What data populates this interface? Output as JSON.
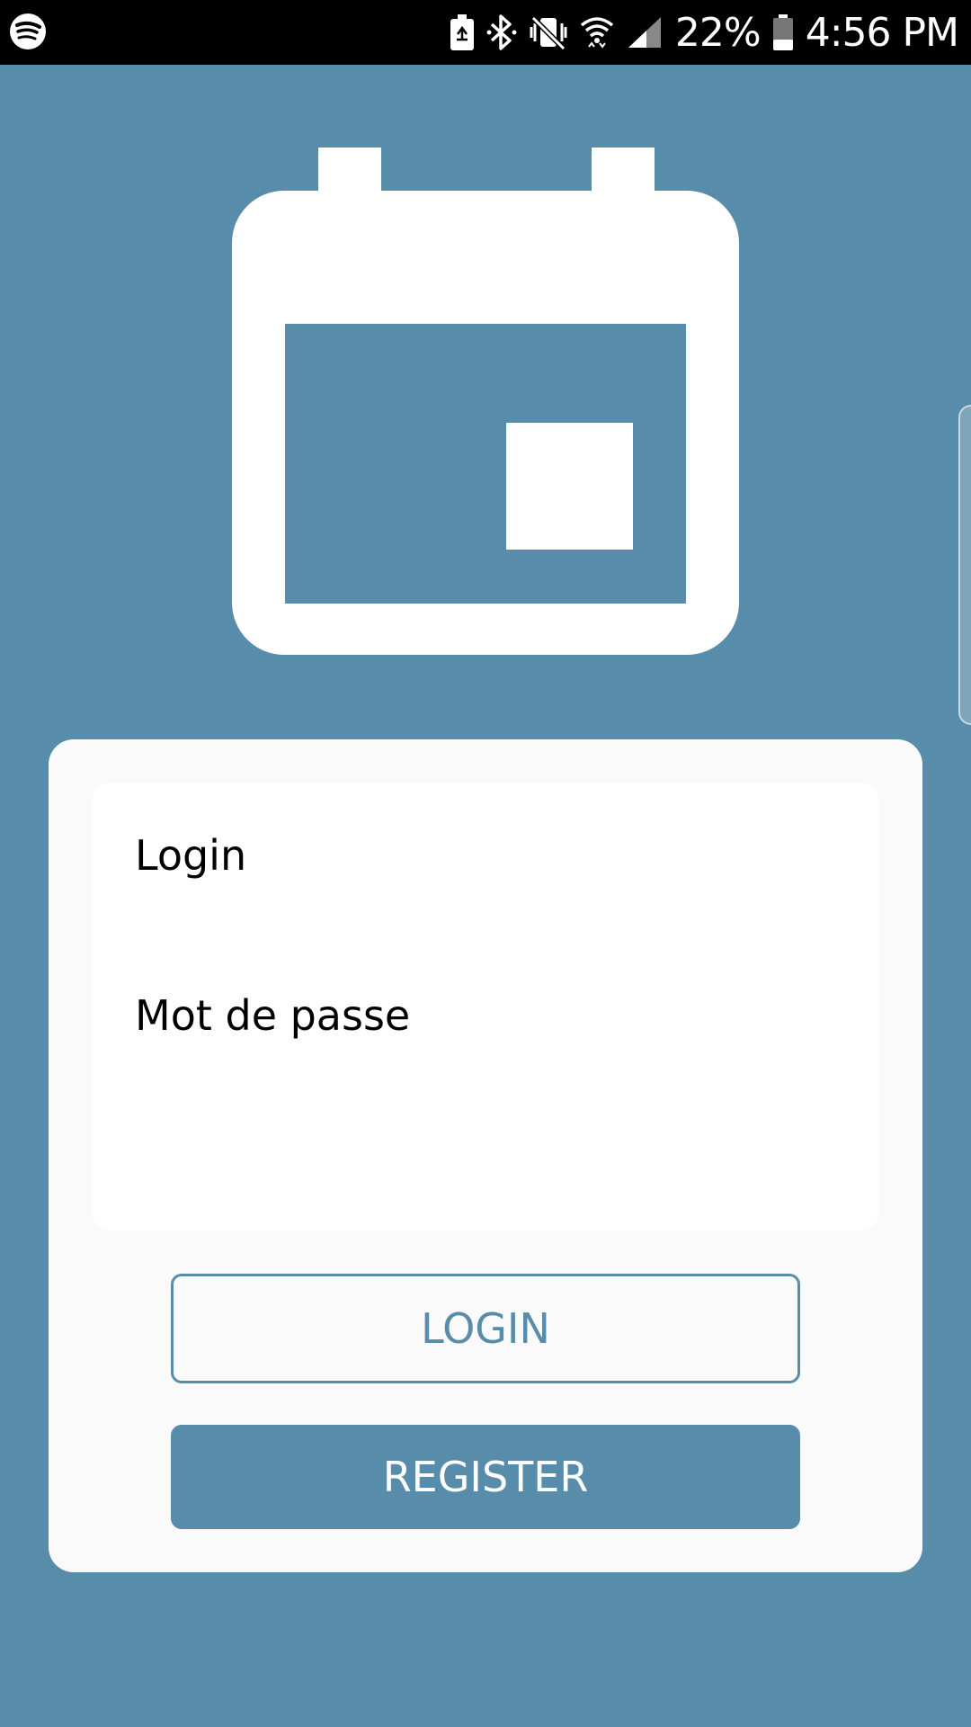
{
  "status_bar": {
    "battery_percent": "22%",
    "time": "4:56 PM",
    "icons": [
      "spotify-icon",
      "battery-saver-icon",
      "bluetooth-icon",
      "vibrate-mute-icon",
      "wifi-icon",
      "cell-signal-icon",
      "battery-icon"
    ]
  },
  "app": {
    "logo_icon": "calendar-icon",
    "accent_color": "#578daa"
  },
  "form": {
    "login_label": "Login",
    "login_value": "",
    "password_label": "Mot de passe",
    "password_value": ""
  },
  "buttons": {
    "login_label": "LOGIN",
    "register_label": "REGISTER"
  }
}
